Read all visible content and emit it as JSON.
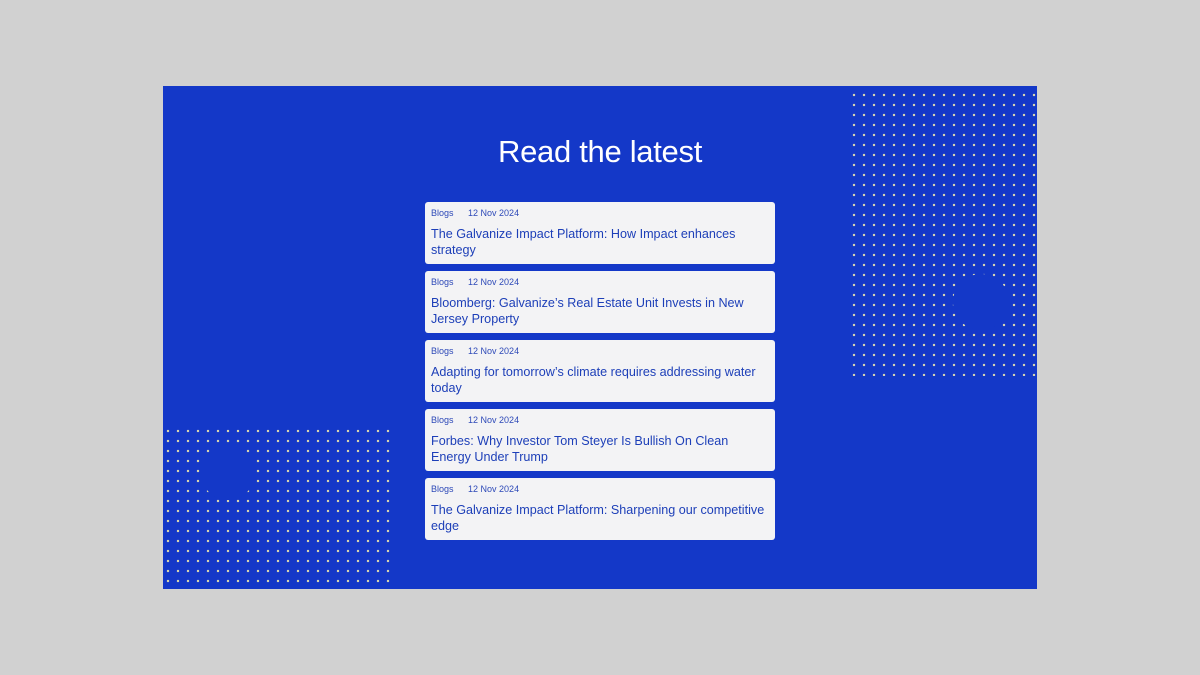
{
  "section": {
    "heading": "Read the latest"
  },
  "articles": [
    {
      "category": "Blogs",
      "date": "12 Nov 2024",
      "title": "The Galvanize Impact Platform: How Impact enhances strategy"
    },
    {
      "category": "Blogs",
      "date": "12 Nov 2024",
      "title": "Bloomberg: Galvanize’s Real Estate Unit Invests in New Jersey Property"
    },
    {
      "category": "Blogs",
      "date": "12 Nov 2024",
      "title": "Adapting for tomorrow’s climate requires addressing water today"
    },
    {
      "category": "Blogs",
      "date": "12 Nov 2024",
      "title": "Forbes: Why Investor Tom Steyer Is Bullish On Clean Energy Under Trump"
    },
    {
      "category": "Blogs",
      "date": "12 Nov 2024",
      "title": "The Galvanize Impact Platform: Sharpening our competitive edge"
    }
  ],
  "colors": {
    "panel": "#1438c8",
    "card": "#f3f3f5",
    "text_accent": "#1d3fb8",
    "page_background": "#d1d1d1"
  }
}
